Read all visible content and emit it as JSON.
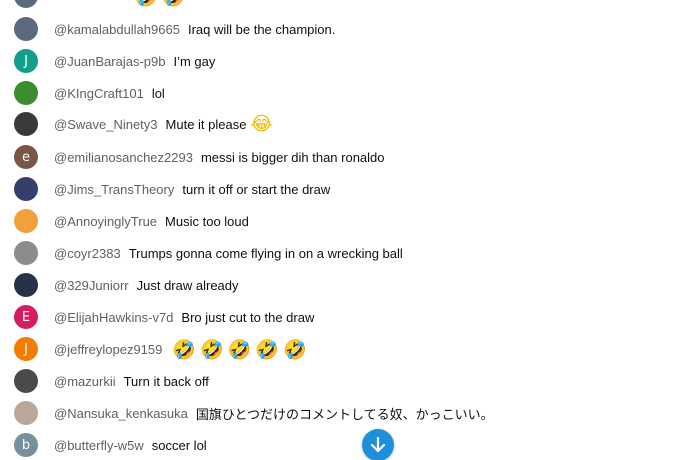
{
  "chat": {
    "messages": [
      {
        "author": "@kamalabdullah9665",
        "text": "Iraq will be the champion.",
        "avatar_color": "#5b6b7d",
        "avatar_initial": ""
      },
      {
        "author": "@JuanBarajas-p9b",
        "text": "I’m gay",
        "avatar_color": "#129e8c",
        "avatar_initial": "J"
      },
      {
        "author": "@KIngCraft101",
        "text": "lol",
        "avatar_color": "#3c8d2f",
        "avatar_initial": ""
      },
      {
        "author": "@Swave_Ninety3",
        "text": "Mute it please",
        "emoji": "😂",
        "avatar_color": "#3a3a3a",
        "avatar_initial": ""
      },
      {
        "author": "@emilianosanchez2293",
        "text": "messi is bigger dih than ronaldo",
        "avatar_color": "#7a5548",
        "avatar_initial": "e"
      },
      {
        "author": "@Jims_TransTheory",
        "text": "turn it off or start the draw",
        "avatar_color": "#34406b",
        "avatar_initial": ""
      },
      {
        "author": "@AnnoyinglyTrue",
        "text": "Music too loud",
        "avatar_color": "#f2a03c",
        "avatar_initial": ""
      },
      {
        "author": "@coyr2383",
        "text": "Trumps gonna come flying in on a wrecking ball",
        "avatar_color": "#8c8c8c",
        "avatar_initial": ""
      },
      {
        "author": "@329Juniorr",
        "text": "Just draw already",
        "avatar_color": "#27324a",
        "avatar_initial": ""
      },
      {
        "author": "@ElijahHawkins-v7d",
        "text": "Bro just cut to the draw",
        "avatar_color": "#d81b60",
        "avatar_initial": "E"
      },
      {
        "author": "@jeffreylopez9159",
        "text": "",
        "emoji": "🤣🤣🤣🤣🤣",
        "avatar_color": "#f57c00",
        "avatar_initial": "J"
      },
      {
        "author": "@mazurkii",
        "text": "Turn it back off",
        "avatar_color": "#4a4a4a",
        "avatar_initial": ""
      },
      {
        "author": "@Nansuka_kenkasuka",
        "text": "国旗ひとつだけのコメントしてる奴、かっこいい。",
        "avatar_color": "#b9a79a",
        "avatar_initial": ""
      },
      {
        "author": "@butterfly-w5w",
        "text": "soccer lol",
        "avatar_color": "#78909c",
        "avatar_initial": "b"
      }
    ],
    "top_partial_emoji": "🤣🤣",
    "scroll_button_icon": "arrow-down-icon",
    "accent_color": "#1f8fdc"
  }
}
